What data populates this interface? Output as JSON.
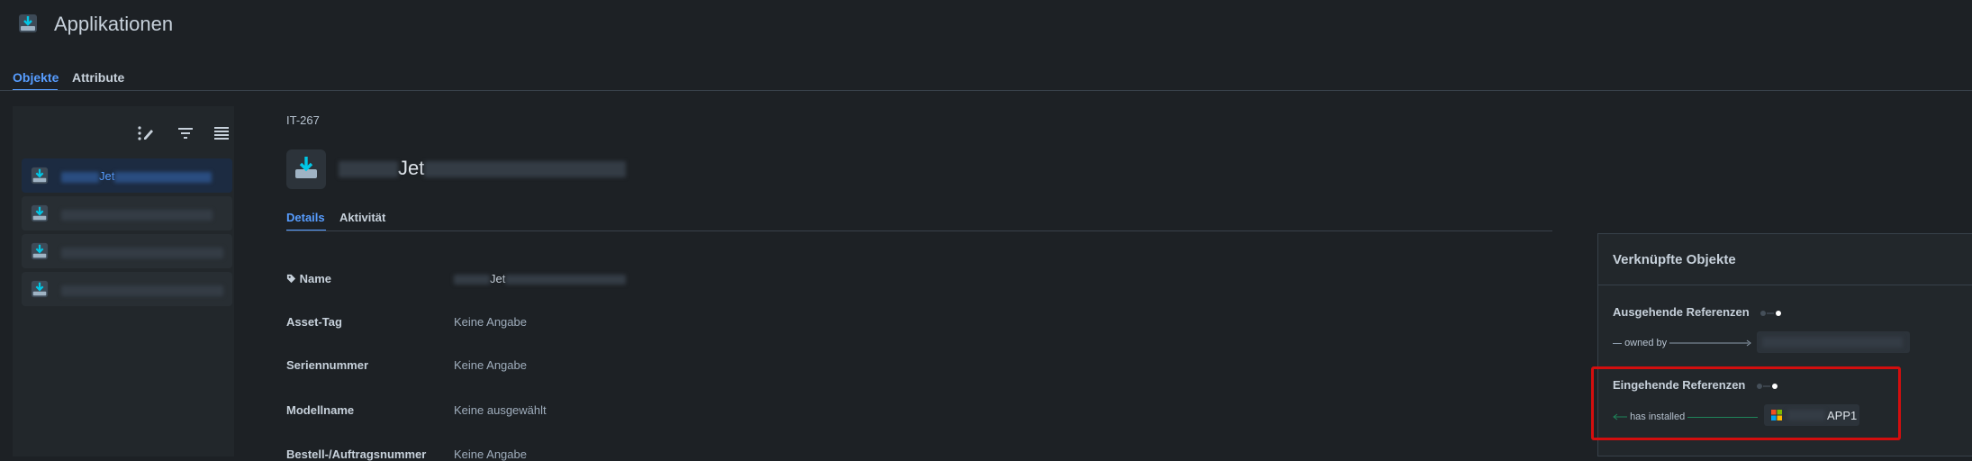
{
  "header": {
    "title": "Applikationen"
  },
  "top_tabs": [
    {
      "label": "Objekte",
      "active": true
    },
    {
      "label": "Attribute",
      "active": false
    }
  ],
  "toolbar": {
    "icons": [
      "edit-columns-icon",
      "filter-icon",
      "list-view-icon"
    ]
  },
  "object_list": [
    {
      "visible_text": "Jet",
      "selected": true
    },
    {
      "visible_text": "",
      "selected": false
    },
    {
      "visible_text": "",
      "selected": false
    },
    {
      "visible_text": "",
      "selected": false
    }
  ],
  "object": {
    "key": "IT-267",
    "title_visible": "Jet",
    "tabs": [
      {
        "label": "Details",
        "active": true
      },
      {
        "label": "Aktivität",
        "active": false
      }
    ],
    "fields": [
      {
        "label": "Name",
        "value": "Jet"
      },
      {
        "label": "Asset-Tag",
        "value": "Keine Angabe"
      },
      {
        "label": "Seriennummer",
        "value": "Keine Angabe"
      },
      {
        "label": "Modellname",
        "value": "Keine ausgewählt"
      },
      {
        "label": "Bestell-/Auftragsnummer",
        "value": "Keine Angabe"
      }
    ]
  },
  "linked": {
    "title": "Verknüpfte Objekte",
    "outgoing": {
      "label": "Ausgehende Referenzen",
      "relation": "owned by"
    },
    "incoming": {
      "label": "Eingehende Referenzen",
      "relation": "has installed",
      "target": "APP1"
    }
  },
  "colors": {
    "background": "#1d2125",
    "accent": "#579dff",
    "highlight": "#d30e0e",
    "teal_line": "#1f845a"
  }
}
